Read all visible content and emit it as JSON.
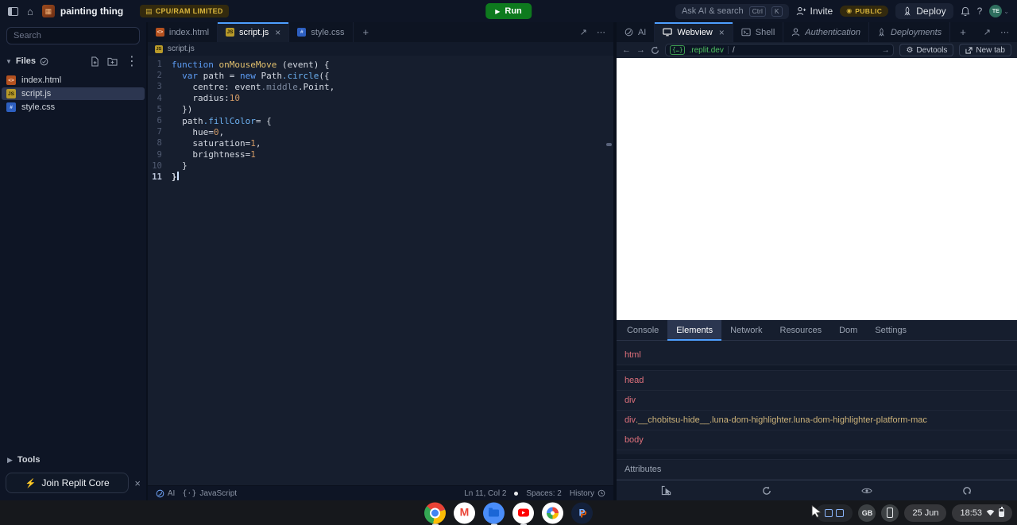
{
  "topbar": {
    "project_name": "painting thing",
    "resource_badge": "CPU/RAM LIMITED",
    "run_label": "Run",
    "search_placeholder": "Ask AI & search",
    "search_key_1": "Ctrl",
    "search_key_2": "K",
    "invite_label": "Invite",
    "visibility_badge": "PUBLIC",
    "deploy_label": "Deploy",
    "help_label": "?",
    "avatar_initials": "TE"
  },
  "sidebar": {
    "search_placeholder": "Search",
    "files_header": "Files",
    "files": [
      {
        "name": "index.html",
        "type": "html",
        "selected": false
      },
      {
        "name": "script.js",
        "type": "js",
        "selected": true
      },
      {
        "name": "style.css",
        "type": "css",
        "selected": false
      }
    ],
    "tools_label": "Tools",
    "join_core_label": "Join Replit Core"
  },
  "editor": {
    "tabs": [
      {
        "label": "index.html",
        "type": "html",
        "active": false
      },
      {
        "label": "script.js",
        "type": "js",
        "active": true
      },
      {
        "label": "style.css",
        "type": "css",
        "active": false
      }
    ],
    "breadcrumb": "script.js",
    "code_lines": [
      {
        "n": 1,
        "segs": [
          [
            "kw",
            "function"
          ],
          [
            "pl",
            " "
          ],
          [
            "fn",
            "onMouseMove"
          ],
          [
            "pl",
            " (event) {"
          ]
        ]
      },
      {
        "n": 2,
        "segs": [
          [
            "pl",
            "  "
          ],
          [
            "kw",
            "var"
          ],
          [
            "pl",
            " path = "
          ],
          [
            "kw",
            "new"
          ],
          [
            "pl",
            " Path"
          ],
          [
            "me",
            ".circle"
          ],
          [
            "pl",
            "({"
          ]
        ]
      },
      {
        "n": 3,
        "segs": [
          [
            "pl",
            "    centre: event"
          ],
          [
            "pr",
            ".middle"
          ],
          [
            "pl",
            ".Point,"
          ]
        ]
      },
      {
        "n": 4,
        "segs": [
          [
            "pl",
            "    radius:"
          ],
          [
            "nu",
            "10"
          ]
        ]
      },
      {
        "n": 5,
        "segs": [
          [
            "pl",
            "  })"
          ]
        ]
      },
      {
        "n": 6,
        "segs": [
          [
            "pl",
            "  path"
          ],
          [
            "me",
            ".fillColor"
          ],
          [
            "pl",
            "= {"
          ]
        ]
      },
      {
        "n": 7,
        "segs": [
          [
            "pl",
            "    hue="
          ],
          [
            "nu",
            "0"
          ],
          [
            "pl",
            ","
          ]
        ]
      },
      {
        "n": 8,
        "segs": [
          [
            "pl",
            "    saturation="
          ],
          [
            "nu",
            "1"
          ],
          [
            "pl",
            ","
          ]
        ]
      },
      {
        "n": 9,
        "segs": [
          [
            "pl",
            "    brightness="
          ],
          [
            "nu",
            "1"
          ]
        ]
      },
      {
        "n": 10,
        "segs": [
          [
            "pl",
            "  }"
          ]
        ]
      },
      {
        "n": 11,
        "segs": [
          [
            "pl",
            "}"
          ]
        ],
        "active": true,
        "caret": true
      }
    ],
    "status": {
      "ai": "AI",
      "language": "JavaScript",
      "cursor_position": "Ln 11, Col 2",
      "spaces": "Spaces: 2",
      "history": "History"
    }
  },
  "panel": {
    "tabs": [
      {
        "label": "AI",
        "icon": "ai",
        "active": false
      },
      {
        "label": "Webview",
        "icon": "monitor",
        "active": true,
        "closable": true
      },
      {
        "label": "Shell",
        "icon": "shell",
        "active": false
      },
      {
        "label": "Authentication",
        "icon": "person",
        "active": false,
        "italic": true
      },
      {
        "label": "Deployments",
        "icon": "rocket",
        "active": false,
        "italic": true
      }
    ],
    "nav": {
      "url_badge": "{…}",
      "url_host": ".replit.dev",
      "url_path": "/",
      "devtools_label": "Devtools",
      "newtab_label": "New tab"
    }
  },
  "devtools": {
    "tabs": [
      {
        "label": "Console",
        "active": false
      },
      {
        "label": "Elements",
        "active": true
      },
      {
        "label": "Network",
        "active": false
      },
      {
        "label": "Resources",
        "active": false
      },
      {
        "label": "Dom",
        "active": false
      },
      {
        "label": "Settings",
        "active": false
      }
    ],
    "tree": [
      {
        "tag": "html",
        "classes": ""
      },
      {
        "tag": "head",
        "classes": ""
      },
      {
        "tag": "div",
        "classes": ""
      },
      {
        "tag": "div",
        "classes": ".__chobitsu-hide__.luna-dom-highlighter.luna-dom-highlighter-platform-mac"
      },
      {
        "tag": "body",
        "classes": ""
      }
    ],
    "attributes_label": "Attributes"
  },
  "taskbar": {
    "apps": [
      {
        "name": "chrome",
        "running": true
      },
      {
        "name": "gmail",
        "running": false
      },
      {
        "name": "files",
        "running": true
      },
      {
        "name": "youtube",
        "running": true
      },
      {
        "name": "photos",
        "running": false
      },
      {
        "name": "paint",
        "running": false
      }
    ],
    "keyboard_layout": "GB",
    "date": "25 Jun",
    "time": "18:53"
  },
  "colors": {
    "accent_blue": "#4e9fff",
    "run_green": "#0e7a1e",
    "badge_gold": "#d8b53c",
    "url_green": "#50c462",
    "dom_tag_red": "#e0717c",
    "dom_class_tan": "#cdb37a"
  }
}
